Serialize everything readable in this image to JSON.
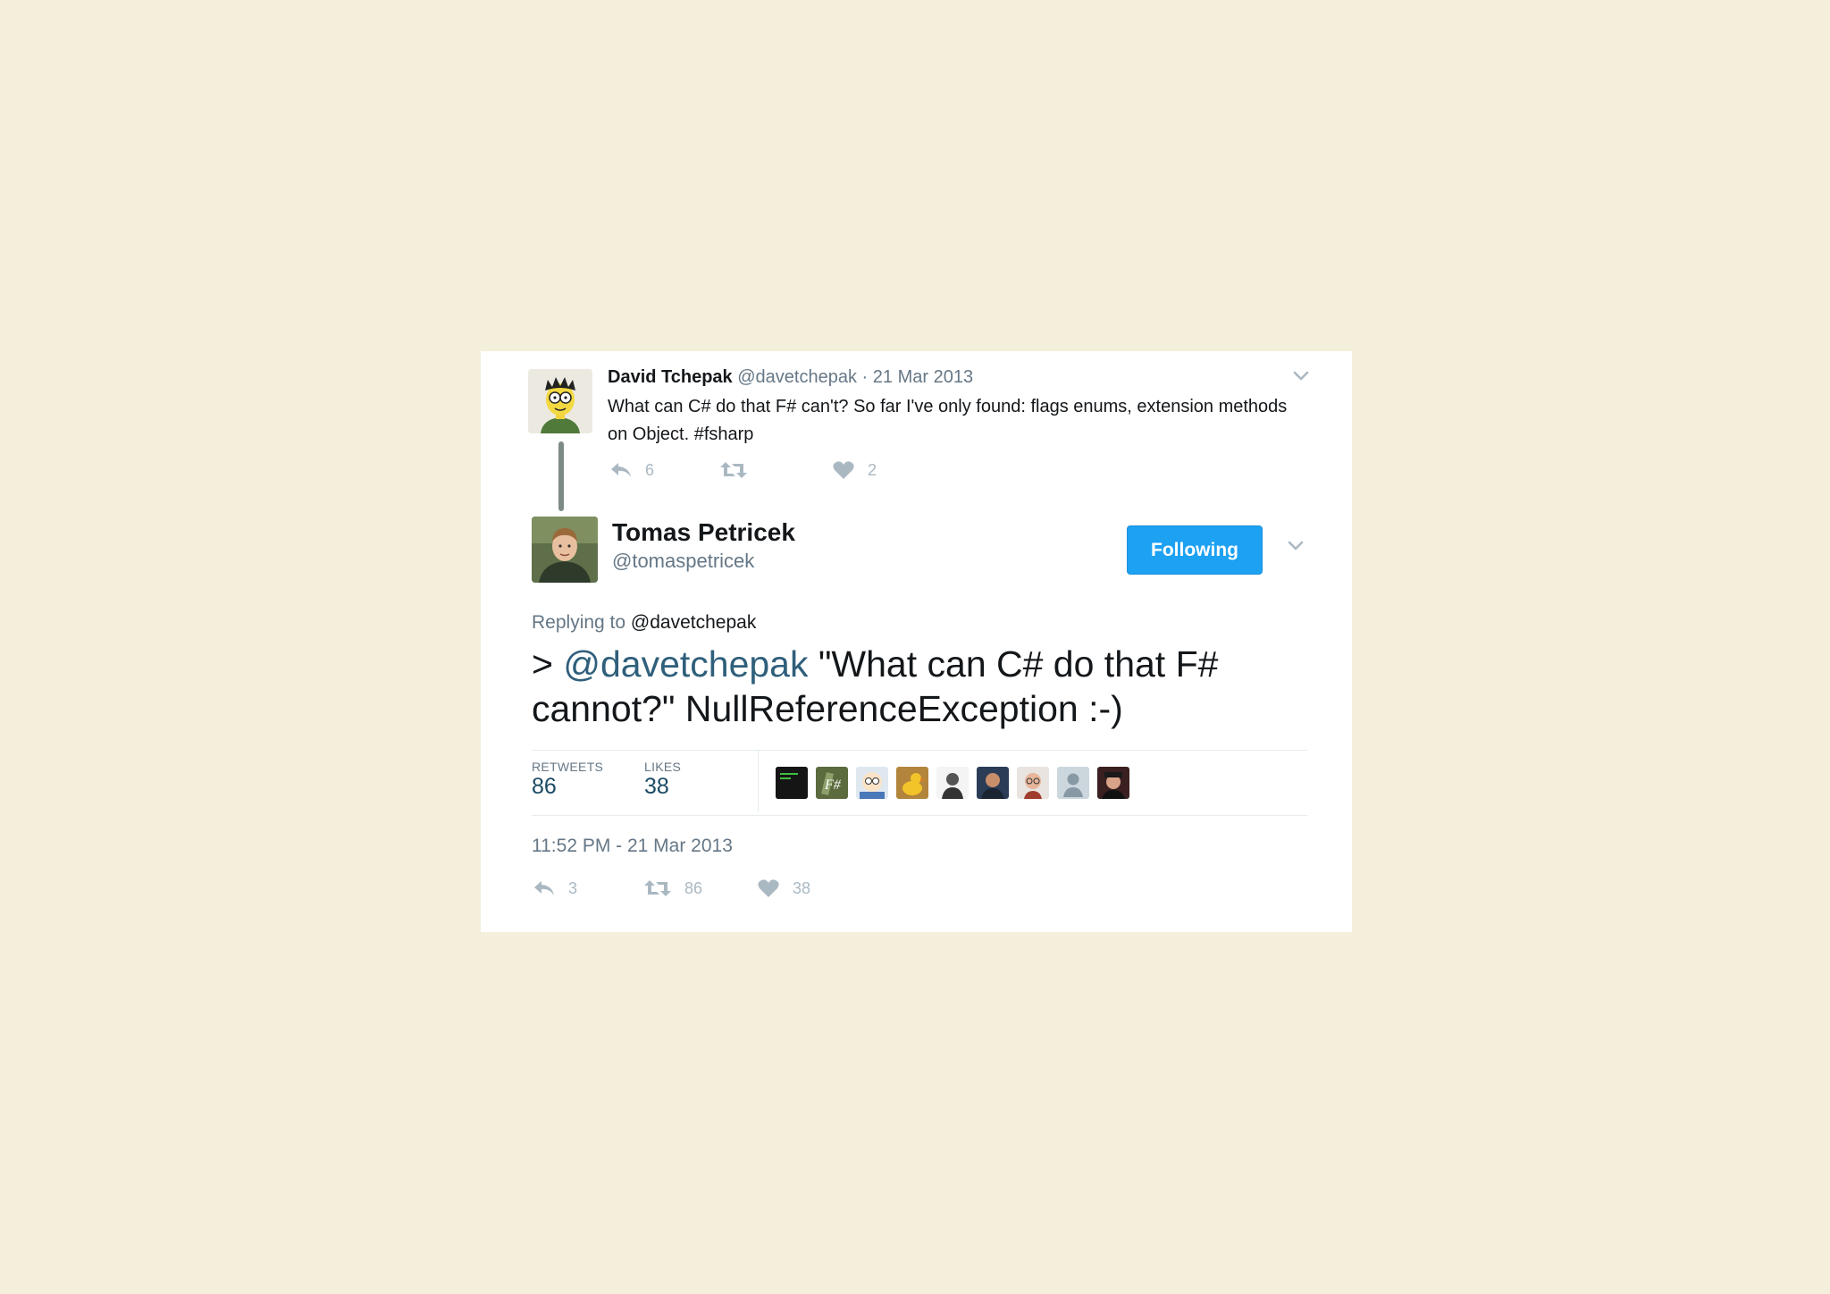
{
  "parent_tweet": {
    "author_name": "David Tchepak",
    "author_handle": "@davetchepak",
    "separator": "·",
    "date": "21 Mar 2013",
    "text": "What can C# do that F# can't? So far I've only found: flags enums, extension methods on Object. #fsharp",
    "reply_count": "6",
    "like_count": "2",
    "avatar_icon": "cartoon-avatar-icon"
  },
  "main_tweet": {
    "author_name": "Tomas Petricek",
    "author_handle": "@tomaspetricek",
    "follow_label": "Following",
    "replying_label": "Replying to",
    "replying_to": "@davetchepak",
    "text_prefix": "> ",
    "text_mention": "@davetchepak",
    "text_body": " \"What can C# do that F# cannot?\"  NullReferenceException :-)",
    "stats": {
      "retweets_label": "RETWEETS",
      "retweets_value": "86",
      "likes_label": "LIKES",
      "likes_value": "38"
    },
    "liker_avatars": [
      "terminal-avatar",
      "fsharp-avatar",
      "cartoon-face-avatar",
      "duck-avatar",
      "person-avatar-1",
      "person-avatar-2",
      "person-avatar-3",
      "default-avatar",
      "person-avatar-4"
    ],
    "timestamp": "11:52 PM - 21 Mar 2013",
    "actions": {
      "reply_count": "3",
      "retweet_count": "86",
      "like_count": "38"
    }
  },
  "colors": {
    "page_bg": "#f3efdb",
    "card_bg": "#ffffff",
    "accent": "#1da1f2",
    "muted": "#657786",
    "icon": "#aab8c2"
  }
}
